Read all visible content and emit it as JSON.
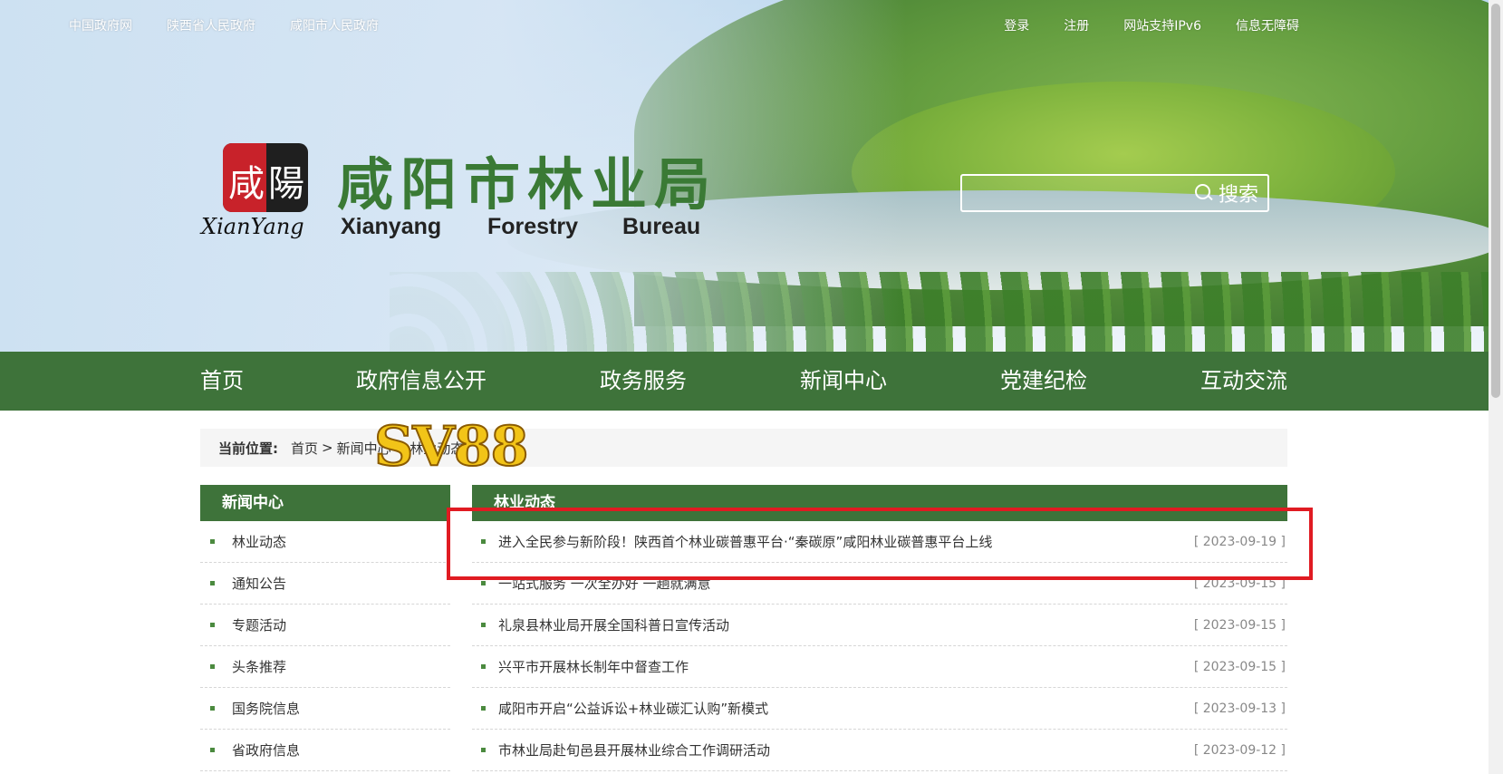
{
  "top_links_left": [
    "中国政府网",
    "陕西省人民政府",
    "咸阳市人民政府"
  ],
  "top_links_right": [
    "登录",
    "注册",
    "网站支持IPv6",
    "信息无障碍"
  ],
  "logo": {
    "seal_text_left": "咸",
    "seal_text_right": "陽",
    "script_text": "XianYang"
  },
  "site": {
    "title": "咸阳市林业局",
    "en_words": [
      "Xianyang",
      "Forestry",
      "Bureau"
    ]
  },
  "search": {
    "placeholder": "",
    "button_label": "搜索",
    "icon": "search-icon"
  },
  "nav": [
    "首页",
    "政府信息公开",
    "政务服务",
    "新闻中心",
    "党建纪检",
    "互动交流"
  ],
  "breadcrumb": {
    "label": "当前位置:",
    "items": [
      "首页",
      ">",
      "新闻中心",
      ">",
      "林业动态"
    ]
  },
  "watermark": "SV88",
  "sidebar": {
    "title": "新闻中心",
    "items": [
      "林业动态",
      "通知公告",
      "专题活动",
      "头条推荐",
      "国务院信息",
      "省政府信息"
    ]
  },
  "news": {
    "title": "林业动态",
    "rows": [
      {
        "title": "进入全民参与新阶段！陕西首个林业碳普惠平台·“秦碳原”咸阳林业碳普惠平台上线",
        "date": "[ 2023-09-19 ]"
      },
      {
        "title": "一站式服务 一次全办好 一趟就满意",
        "date": "[ 2023-09-15 ]"
      },
      {
        "title": "礼泉县林业局开展全国科普日宣传活动",
        "date": "[ 2023-09-15 ]"
      },
      {
        "title": "兴平市开展林长制年中督查工作",
        "date": "[ 2023-09-15 ]"
      },
      {
        "title": "咸阳市开启“公益诉讼+林业碳汇认购”新模式",
        "date": "[ 2023-09-13 ]"
      },
      {
        "title": "市林业局赴旬邑县开展林业综合工作调研活动",
        "date": "[ 2023-09-12 ]"
      }
    ]
  },
  "colors": {
    "brand_green": "#3e733a",
    "title_green": "#3a7a35",
    "highlight_red": "#e01b22"
  }
}
